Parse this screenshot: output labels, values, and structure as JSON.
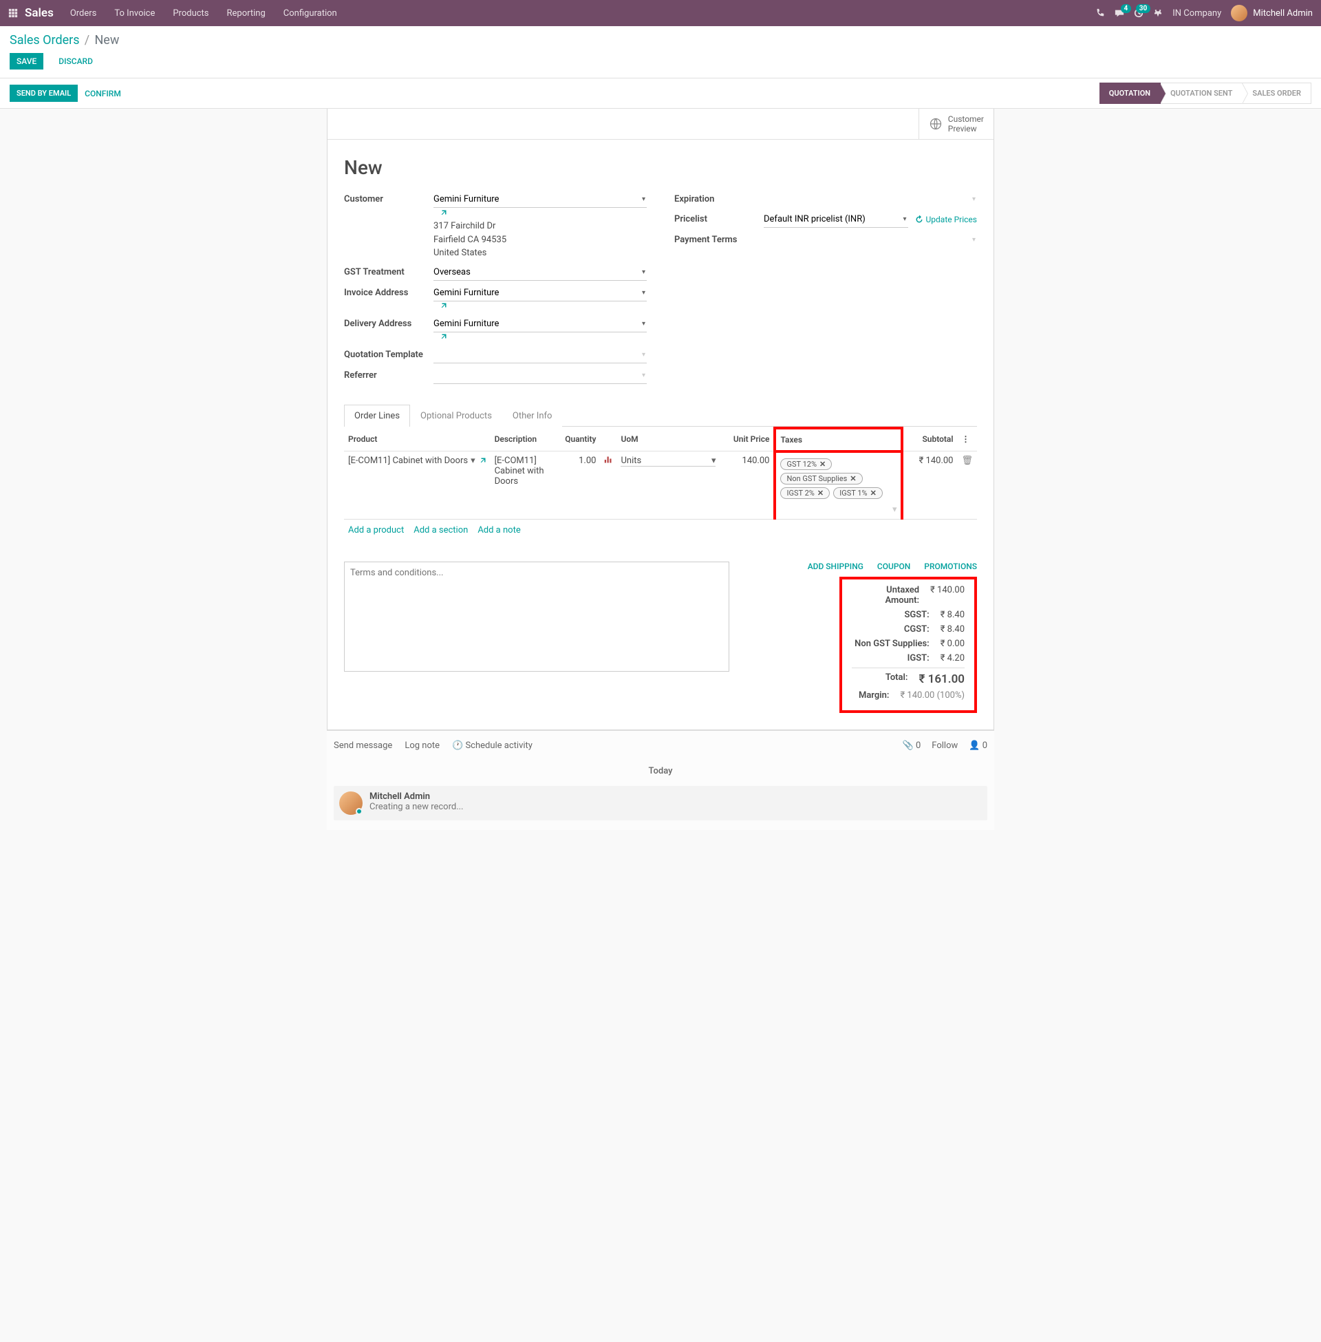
{
  "nav": {
    "brand": "Sales",
    "menu": [
      "Orders",
      "To Invoice",
      "Products",
      "Reporting",
      "Configuration"
    ],
    "msg_badge": "4",
    "act_badge": "30",
    "company": "IN Company",
    "user": "Mitchell Admin"
  },
  "breadcrumb": {
    "parent": "Sales Orders",
    "current": "New"
  },
  "buttons": {
    "save": "SAVE",
    "discard": "DISCARD",
    "send": "SEND BY EMAIL",
    "confirm": "CONFIRM"
  },
  "steps": [
    "QUOTATION",
    "QUOTATION SENT",
    "SALES ORDER"
  ],
  "statbtn": {
    "cust_preview_l1": "Customer",
    "cust_preview_l2": "Preview"
  },
  "form": {
    "title": "New",
    "labels": {
      "customer": "Customer",
      "gst": "GST Treatment",
      "invaddr": "Invoice Address",
      "deladdr": "Delivery Address",
      "qtmpl": "Quotation Template",
      "referrer": "Referrer",
      "expiration": "Expiration",
      "pricelist": "Pricelist",
      "payterms": "Payment Terms"
    },
    "customer": "Gemini Furniture",
    "address": {
      "line1": "317 Fairchild Dr",
      "line2": "Fairfield CA 94535",
      "line3": "United States"
    },
    "gst": "Overseas",
    "invaddr": "Gemini Furniture",
    "deladdr": "Gemini Furniture",
    "pricelist": "Default INR pricelist (INR)",
    "update_prices": "Update Prices"
  },
  "tabs": [
    "Order Lines",
    "Optional Products",
    "Other Info"
  ],
  "table": {
    "headers": {
      "product": "Product",
      "description": "Description",
      "quantity": "Quantity",
      "uom": "UoM",
      "unitprice": "Unit Price",
      "taxes": "Taxes",
      "subtotal": "Subtotal"
    },
    "rows": [
      {
        "product": "[E-COM11] Cabinet with Doors",
        "description": "[E-COM11] Cabinet with Doors",
        "quantity": "1.00",
        "uom": "Units",
        "unitprice": "140.00",
        "taxes": [
          "GST 12%",
          "Non GST Supplies",
          "IGST 2%",
          "IGST 1%"
        ],
        "subtotal": "₹ 140.00"
      }
    ],
    "addlinks": {
      "product": "Add a product",
      "section": "Add a section",
      "note": "Add a note"
    }
  },
  "terms_placeholder": "Terms and conditions...",
  "actions": {
    "ship": "ADD SHIPPING",
    "coupon": "COUPON",
    "promo": "PROMOTIONS"
  },
  "totals": {
    "untaxed": {
      "label": "Untaxed Amount:",
      "val": "₹ 140.00"
    },
    "sgst": {
      "label": "SGST:",
      "val": "₹ 8.40"
    },
    "cgst": {
      "label": "CGST:",
      "val": "₹ 8.40"
    },
    "nongst": {
      "label": "Non GST Supplies:",
      "val": "₹ 0.00"
    },
    "igst": {
      "label": "IGST:",
      "val": "₹ 4.20"
    },
    "total": {
      "label": "Total:",
      "val": "₹ 161.00"
    },
    "margin": {
      "label": "Margin:",
      "val": "₹ 140.00 (100%)"
    }
  },
  "chatter": {
    "send": "Send message",
    "log": "Log note",
    "sched": "Schedule activity",
    "attach": "0",
    "follow": "Follow",
    "followers": "0",
    "today": "Today",
    "msg": {
      "author": "Mitchell Admin",
      "text": "Creating a new record..."
    }
  }
}
